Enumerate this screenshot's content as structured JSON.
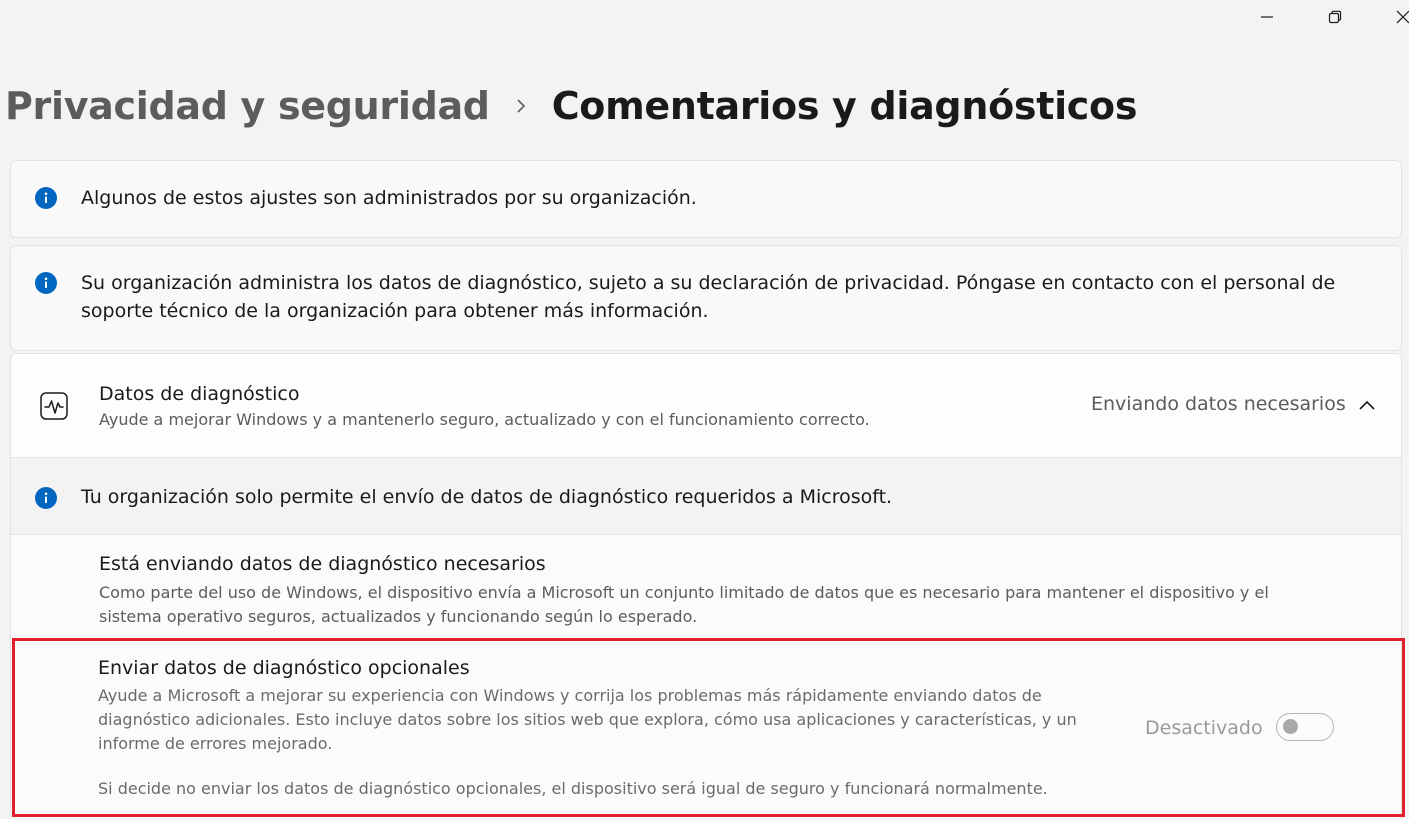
{
  "window": {
    "minimize_icon": "minimize-icon",
    "maximize_icon": "restore-icon",
    "close_icon": "close-icon"
  },
  "breadcrumb": {
    "parent": "Privacidad y seguridad",
    "separator_icon": "chevron-right-icon",
    "current": "Comentarios y diagnósticos"
  },
  "notices": [
    {
      "icon": "info-icon",
      "text": "Algunos de estos ajustes son administrados por su organización."
    },
    {
      "icon": "info-icon",
      "text": "Su organización administra los datos de diagnóstico, sujeto a su declaración de privacidad. Póngase en contacto con el personal de soporte técnico de la organización para obtener más información."
    }
  ],
  "diagnostics": {
    "icon": "activity-pulse-icon",
    "title": "Datos de diagnóstico",
    "subtitle": "Ayude a mejorar Windows y a mantenerlo seguro, actualizado y con el funcionamiento correcto.",
    "status": "Enviando datos necesarios",
    "chevron_icon": "chevron-up-icon",
    "expanded": true,
    "org_notice": {
      "icon": "info-icon",
      "text": "Tu organización solo permite el envío de datos de diagnóstico requeridos a Microsoft."
    },
    "required": {
      "title": "Está enviando datos de diagnóstico necesarios",
      "description_line1": "Como parte del uso de Windows, el dispositivo envía a Microsoft un conjunto limitado de datos que es necesario para mantener el dispositivo y el",
      "description_line2": "sistema operativo seguros, actualizados y funcionando según lo esperado."
    },
    "optional": {
      "title": "Enviar datos de diagnóstico opcionales",
      "description_line1": "Ayude a Microsoft a mejorar su experiencia con Windows y corrija los problemas más rápidamente enviando datos de",
      "description_line2": "diagnóstico adicionales. Esto incluye datos sobre los sitios web que explora, cómo usa aplicaciones y características, y un",
      "description_line3": "informe de errores mejorado.",
      "note": "Si decide no enviar los datos de diagnóstico opcionales, el dispositivo será igual de seguro y funcionará normalmente.",
      "toggle_label": "Desactivado",
      "toggle_on": false,
      "highlight_color": "#e0202e"
    }
  },
  "colors": {
    "accent": "#0067c0",
    "background": "#f3f3f3",
    "card": "#f9f9f9"
  }
}
